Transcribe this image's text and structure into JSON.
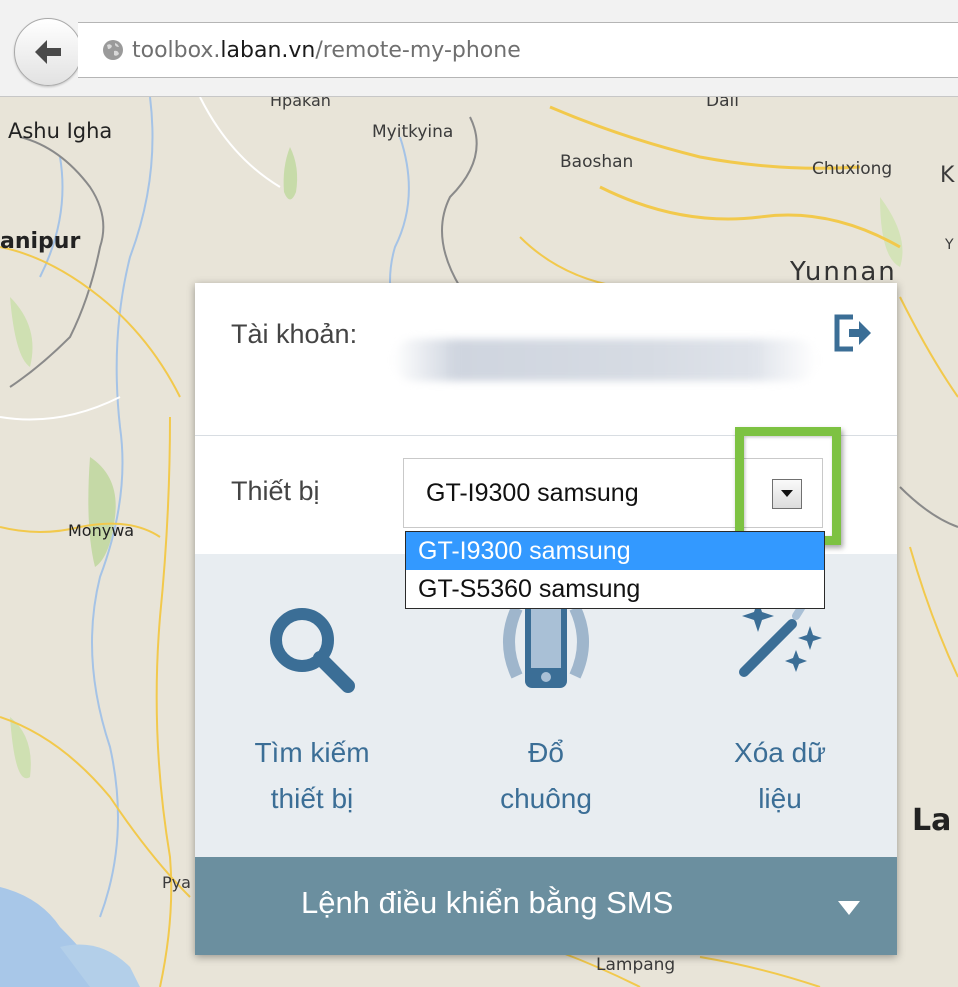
{
  "browser": {
    "url_prefix": "toolbox.",
    "url_domain": "laban.vn",
    "url_path": "/remote-my-phone"
  },
  "map": {
    "labels": [
      "Ashu Igha",
      "Hpakan",
      "Myitkyina",
      "Dali",
      "Baoshan",
      "Chuxiong",
      "K",
      "anipur",
      "Yunnan",
      "Y",
      "Monywa",
      "Pya",
      "Lampang",
      "La"
    ]
  },
  "panel": {
    "account_label": "Tài khoản:",
    "device_label": "Thiết bị",
    "device_selected": "GT-I9300 samsung",
    "device_options": [
      "GT-I9300 samsung",
      "GT-S5360 samsung"
    ],
    "actions": [
      {
        "icon": "search-icon",
        "label_line1": "Tìm kiếm",
        "label_line2": "thiết bị"
      },
      {
        "icon": "phone-ring-icon",
        "label_line1": "Đổ",
        "label_line2": "chuông"
      },
      {
        "icon": "magic-wand-icon",
        "label_line1": "Xóa dữ",
        "label_line2": "liệu"
      }
    ],
    "sms_label": "Lệnh điều khiển bằng SMS"
  },
  "colors": {
    "accent": "#3b6e96",
    "sms_bar": "#6b8f9f",
    "highlight": "#7dc242",
    "selected_option": "#3399ff"
  }
}
